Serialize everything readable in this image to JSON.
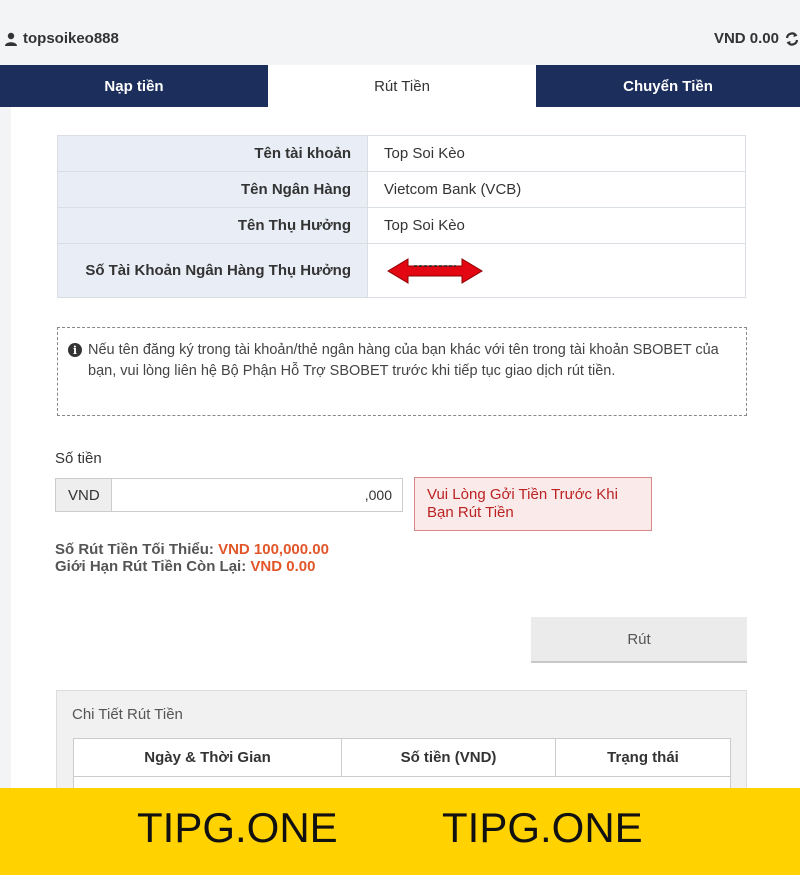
{
  "header": {
    "username": "topsoikeo888",
    "balance": "VND 0.00"
  },
  "tabs": [
    {
      "label": "Nạp tiền"
    },
    {
      "label": "Rút Tiền"
    },
    {
      "label": "Chuyển Tiền"
    }
  ],
  "account_table": [
    {
      "label": "Tên tài khoản",
      "value": "Top Soi Kèo"
    },
    {
      "label": "Tên Ngân Hàng",
      "value": "Vietcom Bank (VCB)"
    },
    {
      "label": "Tên Thụ Hưởng",
      "value": "Top Soi Kèo"
    },
    {
      "label": "Số Tài Khoản Ngân Hàng Thụ Hưởng",
      "value": ""
    }
  ],
  "notice": "Nếu tên đăng ký trong tài khoản/thẻ ngân hàng của bạn khác với tên trong tài khoản SBOBET của bạn, vui lòng liên hệ Bộ Phận Hỗ Trợ SBOBET trước khi tiếp tục giao dịch rút tiền.",
  "amount": {
    "label": "Số tiền",
    "currency": "VND",
    "placeholder": ",000",
    "warning": "Vui Lòng Gởi Tiền Trước Khi Bạn Rút Tiền"
  },
  "limits": {
    "min_label": "Số Rút Tiền Tối Thiểu:",
    "min_value": "VND 100,000.00",
    "remaining_label": "Giới Hạn Rút Tiền Còn Lại:",
    "remaining_value": "VND 0.00"
  },
  "submit_label": "Rút",
  "details": {
    "title": "Chi Tiết Rút Tiền",
    "columns": [
      "Ngày & Thời Gian",
      "Số tiền (VND)",
      "Trạng thái"
    ]
  },
  "watermark": [
    "TIPG.ONE",
    "TIPG.ONE"
  ],
  "colors": {
    "tab_dark": "#1c2e5c",
    "accent_orange": "#e2562a",
    "footer_yellow": "#ffd200"
  }
}
